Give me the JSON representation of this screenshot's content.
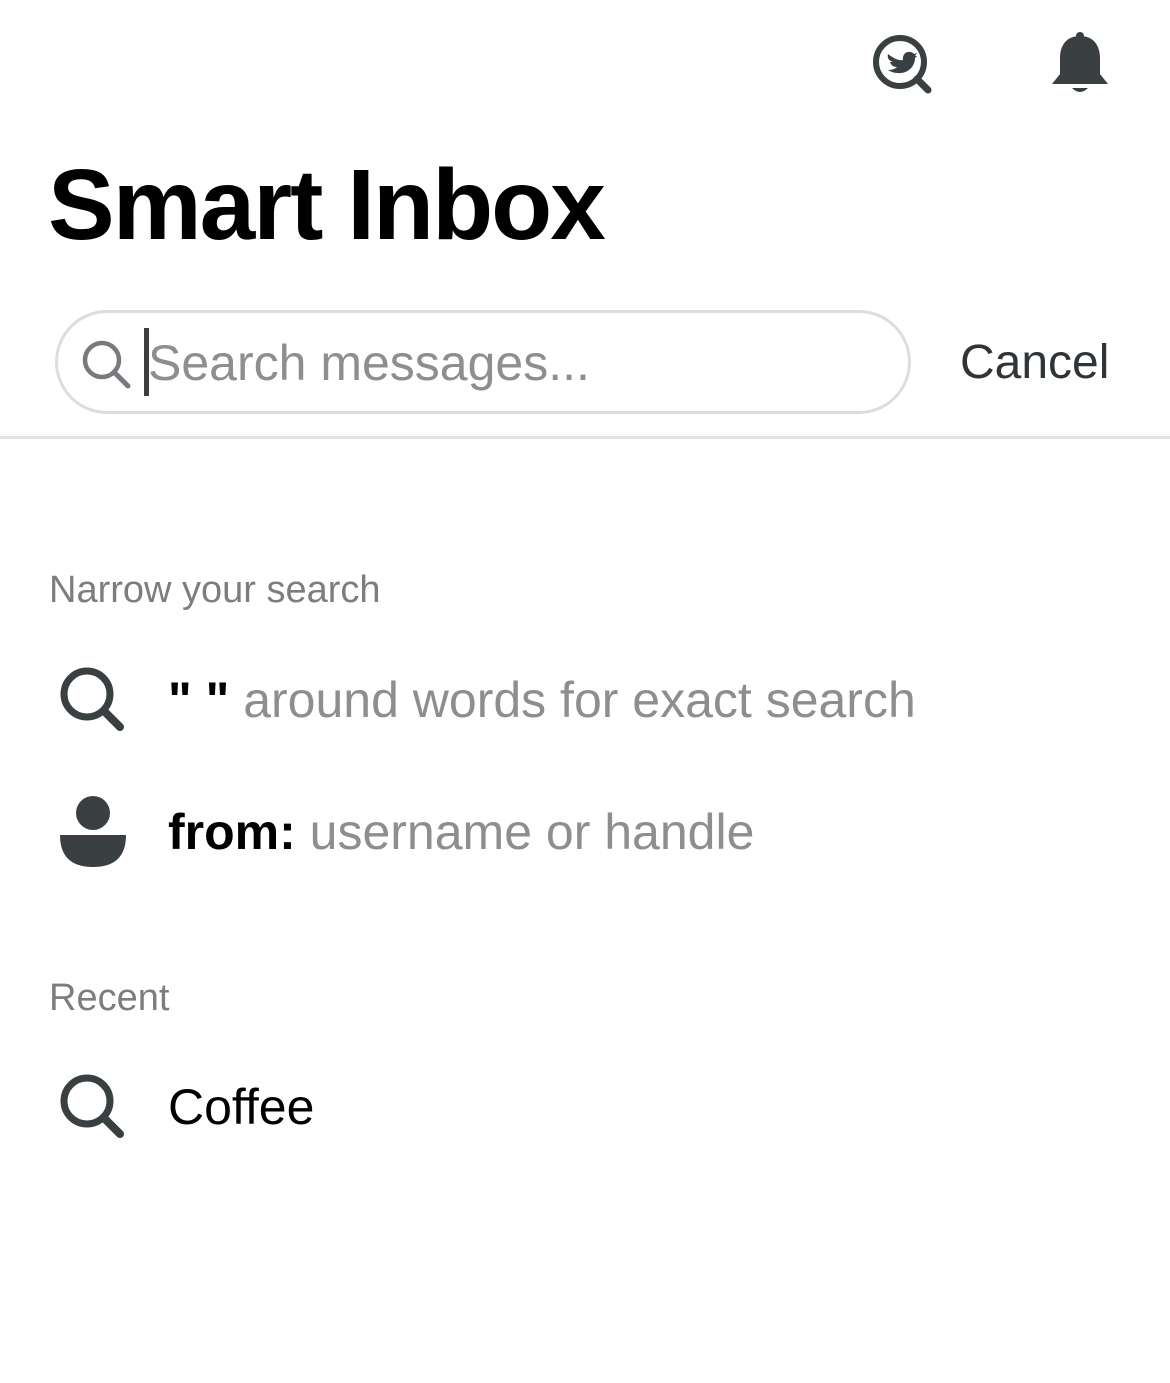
{
  "header": {
    "title": "Smart Inbox",
    "twitter_search_icon": "twitter-search-icon",
    "notifications_icon": "bell-icon"
  },
  "search": {
    "placeholder": "Search messages...",
    "value": "",
    "cancel_label": "Cancel"
  },
  "narrow": {
    "heading": "Narrow your search",
    "items": [
      {
        "icon": "search-icon",
        "keyword": "\" \"",
        "hint": " around words for exact search"
      },
      {
        "icon": "person-icon",
        "keyword": "from:",
        "hint": " username or handle"
      }
    ]
  },
  "recent": {
    "heading": "Recent",
    "items": [
      {
        "icon": "search-icon",
        "label": "Coffee"
      }
    ]
  },
  "colors": {
    "icon": "#3a3f42",
    "muted_text": "#8e8e90",
    "divider": "#e2e2e2",
    "search_border": "#dddddd"
  }
}
